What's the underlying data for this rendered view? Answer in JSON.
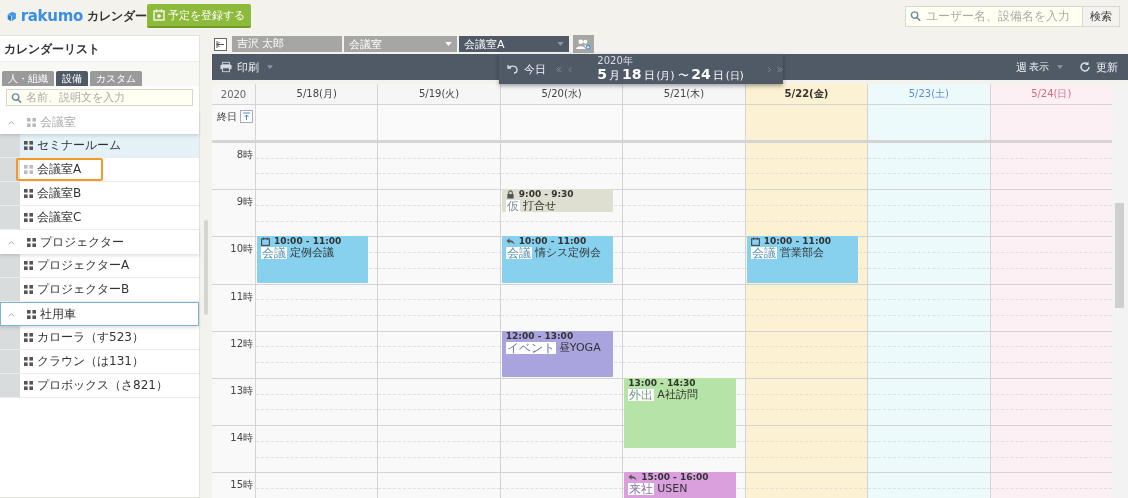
{
  "header": {
    "logo": "rakumo",
    "app_name": "カレンダー",
    "add_button": "予定を登録する",
    "search": {
      "placeholder": "ユーザー名、設備名を入力",
      "button": "検索"
    }
  },
  "sidebar": {
    "title": "カレンダーリスト",
    "tabs": [
      {
        "label": "人・組織",
        "selected": false
      },
      {
        "label": "設備",
        "selected": true
      },
      {
        "label": "カスタム",
        "selected": false
      }
    ],
    "search_placeholder": "名前、説明文を入力",
    "groups": [
      {
        "label": "会議室",
        "expanded": true,
        "dimmed": true,
        "focused": false,
        "children": [
          {
            "label": "セミナールーム",
            "selected": true,
            "marked": false,
            "dimmed": false
          },
          {
            "label": "会議室A",
            "selected": false,
            "marked": true,
            "dimmed": true
          },
          {
            "label": "会議室B",
            "selected": false,
            "marked": false,
            "dimmed": false
          },
          {
            "label": "会議室C",
            "selected": false,
            "marked": false,
            "dimmed": false
          }
        ]
      },
      {
        "label": "プロジェクター",
        "expanded": true,
        "dimmed": false,
        "focused": false,
        "children": [
          {
            "label": "プロジェクターA",
            "selected": false,
            "marked": false,
            "dimmed": false
          },
          {
            "label": "プロジェクターB",
            "selected": false,
            "marked": false,
            "dimmed": false
          }
        ]
      },
      {
        "label": "社用車",
        "expanded": true,
        "dimmed": false,
        "focused": true,
        "children": [
          {
            "label": "カローラ（す523）",
            "selected": false,
            "marked": false,
            "dimmed": false
          },
          {
            "label": "クラウン（は131）",
            "selected": false,
            "marked": false,
            "dimmed": false
          },
          {
            "label": "プロボックス（さ821）",
            "selected": false,
            "marked": false,
            "dimmed": false
          }
        ]
      }
    ]
  },
  "selectors": {
    "user": "吉沢 太郎",
    "category": "会議室",
    "facility": "会議室A"
  },
  "toolbar": {
    "print": "印刷",
    "today": "今日",
    "year": "2020年",
    "range": [
      {
        "text": "5",
        "kind": "num"
      },
      {
        "text": "月",
        "kind": "unit"
      },
      {
        "text": "18",
        "kind": "num"
      },
      {
        "text": "日",
        "kind": "unit"
      },
      {
        "text": "(月)",
        "kind": "small"
      },
      {
        "text": "〜",
        "kind": "unit"
      },
      {
        "text": "24",
        "kind": "num"
      },
      {
        "text": "日",
        "kind": "unit"
      },
      {
        "text": "(日)",
        "kind": "small"
      }
    ],
    "view": "週",
    "view_label": "表示",
    "refresh": "更新"
  },
  "calendar": {
    "year": "2020",
    "allday_label": "終日",
    "days": [
      {
        "label": "5/18(月)",
        "kind": "weekday"
      },
      {
        "label": "5/19(火)",
        "kind": "weekday"
      },
      {
        "label": "5/20(水)",
        "kind": "weekday"
      },
      {
        "label": "5/21(木)",
        "kind": "weekday"
      },
      {
        "label": "5/22(金)",
        "kind": "today"
      },
      {
        "label": "5/23(土)",
        "kind": "saturday"
      },
      {
        "label": "5/24(日)",
        "kind": "sunday"
      }
    ],
    "hours": [
      "8時",
      "9時",
      "10時",
      "11時",
      "12時",
      "13時",
      "14時",
      "15時"
    ],
    "events": [
      {
        "time": "9:00 - 9:30",
        "tag": "仮",
        "title": "打合せ",
        "color": "#dedfd0"
      },
      {
        "time": "10:00 - 11:00",
        "tag": "会議",
        "title": "定例会議",
        "color": "#87d0ee"
      },
      {
        "time": "10:00 - 11:00",
        "tag": "会議",
        "title": "情シス定例会",
        "color": "#87d0ee"
      },
      {
        "time": "10:00 - 11:00",
        "tag": "会議",
        "title": "営業部会",
        "color": "#87d0ee"
      },
      {
        "time": "12:00 - 13:00",
        "tag": "イベント",
        "title": "昼YOGA",
        "color": "#aaa4de"
      },
      {
        "time": "13:00 - 14:30",
        "tag": "外出",
        "title": "A社訪問",
        "color": "#b5e4a6"
      },
      {
        "time": "15:00 - 16:00",
        "tag": "来社",
        "title": "USEN",
        "color": "#daa0de"
      }
    ]
  }
}
